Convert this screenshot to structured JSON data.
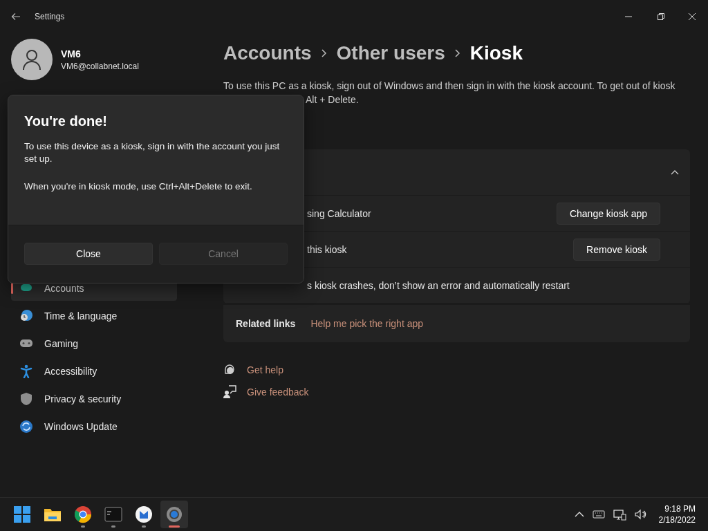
{
  "window": {
    "title": "Settings"
  },
  "profile": {
    "name": "VM6",
    "email": "VM6@collabnet.local"
  },
  "sidebar": {
    "items": [
      {
        "label": "Accounts",
        "selected": true
      },
      {
        "label": "Time & language",
        "selected": false
      },
      {
        "label": "Gaming",
        "selected": false
      },
      {
        "label": "Accessibility",
        "selected": false
      },
      {
        "label": "Privacy & security",
        "selected": false
      },
      {
        "label": "Windows Update",
        "selected": false
      }
    ]
  },
  "breadcrumb": [
    {
      "label": "Accounts",
      "current": false
    },
    {
      "label": "Other users",
      "current": false
    },
    {
      "label": "Kiosk",
      "current": true
    }
  ],
  "description": [
    "To use this PC as a kiosk, sign out of Windows and then sign in with the kiosk account. To get out of kiosk",
    "Alt + Delete."
  ],
  "kiosk_card": {
    "expanded": true,
    "rows": [
      {
        "text": "sing Calculator",
        "button": "Change kiosk app"
      },
      {
        "text": "this kiosk",
        "button": "Remove kiosk"
      },
      {
        "text": "s kiosk crashes, don’t show an error and automatically restart"
      }
    ]
  },
  "related_links": {
    "label": "Related links",
    "links": [
      "Help me pick the right app"
    ]
  },
  "help_links": [
    "Get help",
    "Give feedback"
  ],
  "dialog": {
    "title": "You're done!",
    "paragraphs": [
      "To use this device as a kiosk, sign in with the account you just set up.",
      "When you're in kiosk mode, use Ctrl+Alt+Delete to exit."
    ],
    "buttons": [
      {
        "label": "Close",
        "disabled": false
      },
      {
        "label": "Cancel",
        "disabled": true
      }
    ]
  },
  "taskbar": {
    "apps": [
      {
        "running": false,
        "active": false
      },
      {
        "running": false,
        "active": false
      },
      {
        "running": true,
        "active": false
      },
      {
        "running": true,
        "active": false
      },
      {
        "running": true,
        "active": false
      },
      {
        "running": true,
        "active": true
      }
    ]
  },
  "clock": {
    "time": "9:18 PM",
    "date": "2/18/2022"
  }
}
